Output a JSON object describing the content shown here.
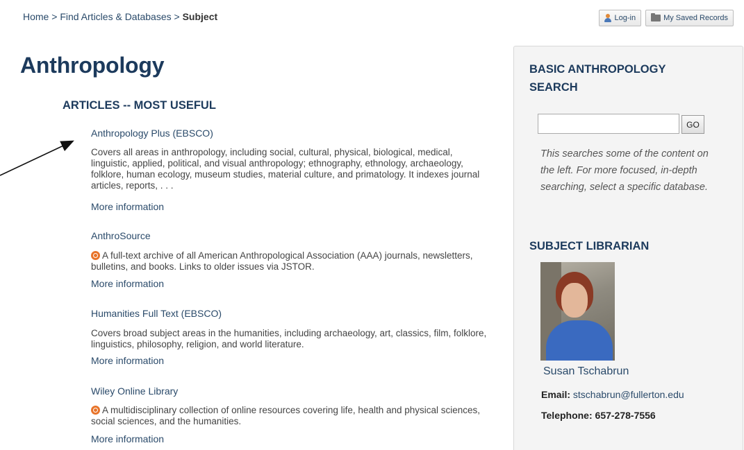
{
  "breadcrumb": {
    "home": "Home",
    "sep1": " > ",
    "find": "Find Articles & Databases",
    "sep2": " > ",
    "current": "Subject"
  },
  "header_buttons": {
    "login": "Log-in",
    "saved": "My Saved Records"
  },
  "page_title": "Anthropology",
  "section_heading": "ARTICLES -- MOST USEFUL",
  "resources": [
    {
      "title": "Anthropology Plus (EBSCO)",
      "description": "Covers all areas in anthropology, including social, cultural, physical, biological, medical, linguistic, applied, political, and visual anthropology; ethnography, ethnology, archaeology, folklore, human ecology, museum studies, material culture, and primatology. It indexes journal articles, reports, . . .",
      "open_access": false,
      "more": "More information"
    },
    {
      "title": "AnthroSource",
      "description": "A full-text archive of all American Anthropological Association (AAA) journals, newsletters, bulletins, and books. Links to older issues via JSTOR.",
      "open_access": true,
      "more": "More information"
    },
    {
      "title": "Humanities Full Text (EBSCO)",
      "description": "Covers broad subject areas in the humanities, including archaeology, art, classics, film, folklore, linguistics, philosophy, religion, and world literature.",
      "open_access": false,
      "more": "More information"
    },
    {
      "title": "Wiley Online Library",
      "description": "A multidisciplinary collection of online resources covering life, health and physical sciences, social sciences, and the humanities.",
      "open_access": true,
      "more": "More information"
    }
  ],
  "sidebar": {
    "search_heading": "BASIC ANTHROPOLOGY SEARCH",
    "search_value": "",
    "go_label": "GO",
    "search_note": "This searches some of the content on the left. For more focused, in-depth searching, select a specific database.",
    "librarian_heading": "SUBJECT LIBRARIAN",
    "librarian_name": "Susan Tschabrun",
    "email_label": "Email:",
    "email": "stschabrun@fullerton.edu",
    "phone_label": "Telephone:",
    "phone": "657-278-7556"
  },
  "colors": {
    "heading": "#1c3a5c",
    "link": "#2a4a6a",
    "open_access_icon": "#e8742a"
  }
}
